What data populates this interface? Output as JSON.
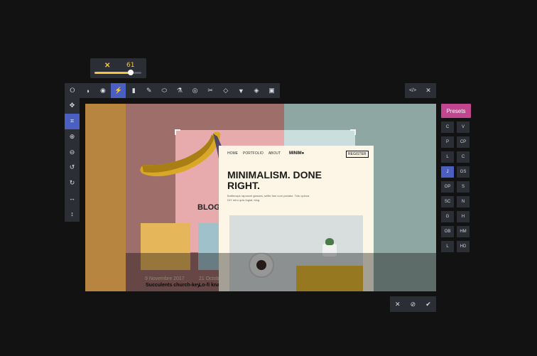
{
  "slider": {
    "close_glyph": "✕",
    "value": "61",
    "fraction": 0.78,
    "accent": "#f5c542"
  },
  "toolbar": {
    "tools": [
      {
        "name": "shape-circle-icon",
        "glyph": "⭘"
      },
      {
        "name": "contrast-icon",
        "glyph": "◑"
      },
      {
        "name": "eye-icon",
        "glyph": "◉"
      },
      {
        "name": "lightning-icon",
        "glyph": "⚡",
        "active": true
      },
      {
        "name": "cylinder-icon",
        "glyph": "▮"
      },
      {
        "name": "eyedropper-icon",
        "glyph": "✎"
      },
      {
        "name": "blob-icon",
        "glyph": "⬭"
      },
      {
        "name": "flask-icon",
        "glyph": "⚗"
      },
      {
        "name": "target-icon",
        "glyph": "◎"
      },
      {
        "name": "scissors-icon",
        "glyph": "✂"
      },
      {
        "name": "diamond-icon",
        "glyph": "◇"
      },
      {
        "name": "filter-icon",
        "glyph": "▼"
      },
      {
        "name": "shield-icon",
        "glyph": "◈"
      },
      {
        "name": "cube-icon",
        "glyph": "▣"
      }
    ],
    "active_color": "#4a5fc1"
  },
  "code_bar": {
    "code_glyph": "</>",
    "close_glyph": "✕"
  },
  "vtoolbar": {
    "tools": [
      {
        "name": "move-icon",
        "glyph": "✥"
      },
      {
        "name": "crop-icon",
        "glyph": "⌗",
        "active": true
      },
      {
        "name": "zoom-in-icon",
        "glyph": "⊕"
      },
      {
        "name": "zoom-out-icon",
        "glyph": "⊖"
      },
      {
        "name": "rotate-left-icon",
        "glyph": "↺"
      },
      {
        "name": "rotate-right-icon",
        "glyph": "↻"
      },
      {
        "name": "flip-horizontal-icon",
        "glyph": "↔"
      },
      {
        "name": "flip-vertical-icon",
        "glyph": "↕"
      }
    ]
  },
  "canvas": {
    "blog_label": "BLOG",
    "caption_left": "9 Novembre 2017",
    "caption_right": "21 Octobre",
    "post_left": "Succulents church-key",
    "post_right": "Lo-fi knaus",
    "card": {
      "nav": [
        "HOME",
        "PORTFOLIO",
        "ABOUT"
      ],
      "logo": "MINIM●",
      "register": "REGISTER",
      "headline": "MINIMALISM. DONE RIGHT.",
      "subtext": "Bottlecaps rapunzel glasses, selfie fam nom pariatur. Tofu quinoa DIY retro quis fugiat, blog."
    }
  },
  "presets": {
    "label": "Presets",
    "color": "#c2458f",
    "items": [
      {
        "label": "C"
      },
      {
        "label": "V"
      },
      {
        "label": "P"
      },
      {
        "label": "CP"
      },
      {
        "label": "L"
      },
      {
        "label": "C"
      },
      {
        "label": "J",
        "active": true
      },
      {
        "label": "GS"
      },
      {
        "label": "OP"
      },
      {
        "label": "S"
      },
      {
        "label": "SC"
      },
      {
        "label": "N"
      },
      {
        "label": "G"
      },
      {
        "label": "H"
      },
      {
        "label": "OB"
      },
      {
        "label": "HM"
      },
      {
        "label": "L"
      },
      {
        "label": "HD"
      }
    ]
  },
  "actions": {
    "cancel_glyph": "✕",
    "reset_glyph": "⊘",
    "apply_glyph": "✔"
  }
}
